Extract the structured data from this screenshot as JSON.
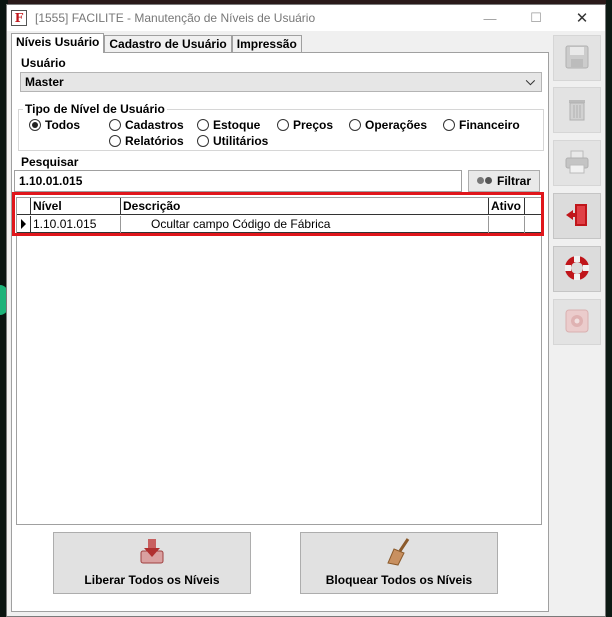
{
  "window": {
    "title": "[1555] FACILITE - Manutenção de Níveis de Usuário",
    "app_icon_letter": "F",
    "minimize_glyph": "—",
    "maximize_glyph": "☐",
    "close_glyph": "✕"
  },
  "tabs": [
    {
      "label": "Níveis Usuário",
      "active": true
    },
    {
      "label": "Cadastro de Usuário",
      "active": false
    },
    {
      "label": "Impressão",
      "active": false
    }
  ],
  "usuario": {
    "label": "Usuário",
    "selected": "Master"
  },
  "tipo_nivel": {
    "legend": "Tipo de Nível de Usuário",
    "options": [
      {
        "label": "Todos",
        "checked": true
      },
      {
        "label": "Cadastros",
        "checked": false
      },
      {
        "label": "Estoque",
        "checked": false
      },
      {
        "label": "Preços",
        "checked": false
      },
      {
        "label": "Operações",
        "checked": false
      },
      {
        "label": "Financeiro",
        "checked": false
      },
      {
        "label": "Relatórios",
        "checked": false
      },
      {
        "label": "Utilitários",
        "checked": false
      }
    ]
  },
  "pesquisar": {
    "label": "Pesquisar",
    "value": "1.10.01.015",
    "filter_label": "Filtrar"
  },
  "grid": {
    "columns": [
      "Nível",
      "Descrição",
      "Ativo"
    ],
    "rows": [
      {
        "nivel": "1.10.01.015",
        "descricao": "Ocultar campo Código de Fábrica",
        "ativo": ""
      }
    ]
  },
  "buttons": {
    "liberar": "Liberar Todos os Níveis",
    "bloquear": "Bloquear Todos os Níveis"
  },
  "toolbar": [
    "save-icon",
    "trash-icon",
    "printer-icon",
    "exit-door-icon",
    "lifebuoy-icon",
    "settings-gear-icon"
  ],
  "colors": {
    "highlight": "#e0161b",
    "accent": "#c0161b"
  }
}
